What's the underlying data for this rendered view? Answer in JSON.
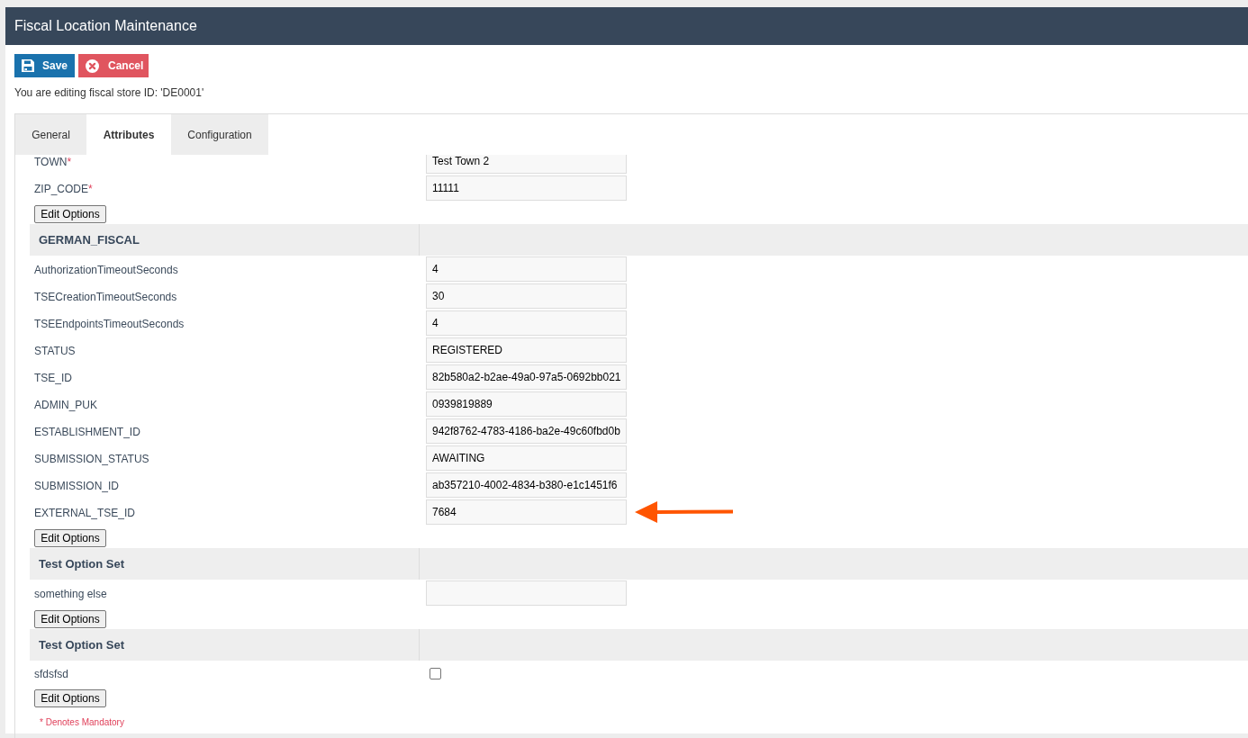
{
  "header": {
    "title": "Fiscal Location Maintenance"
  },
  "toolbar": {
    "buttons": [
      {
        "kind": "save",
        "label": "Save"
      },
      {
        "kind": "cancel",
        "label": "Cancel"
      }
    ]
  },
  "editing_notice": "You are editing fiscal store ID: 'DE0001'",
  "tabs": [
    {
      "label": "General",
      "selected": false
    },
    {
      "label": "Attributes",
      "selected": true
    },
    {
      "label": "Configuration",
      "selected": false
    }
  ],
  "sections": [
    {
      "fields": [
        {
          "label": "TOWN",
          "required_mark": "*",
          "kind": "text",
          "value": "Test Town 2",
          "highlighted": false
        },
        {
          "label": "ZIP_CODE",
          "required_mark": "*",
          "kind": "text",
          "value": "11111",
          "highlighted": false
        }
      ],
      "button": "Edit Options"
    },
    {
      "title": "GERMAN_FISCAL",
      "fields": [
        {
          "label": "AuthorizationTimeoutSeconds",
          "kind": "text",
          "value": "4",
          "highlighted": false
        },
        {
          "label": "TSECreationTimeoutSeconds",
          "kind": "text",
          "value": "30",
          "highlighted": false
        },
        {
          "label": "TSEEndpointsTimeoutSeconds",
          "kind": "text",
          "value": "4",
          "highlighted": false
        },
        {
          "label": "STATUS",
          "kind": "text",
          "value": "REGISTERED",
          "highlighted": false
        },
        {
          "label": "TSE_ID",
          "kind": "text",
          "value": "82b580a2-b2ae-49a0-97a5-0692bb021",
          "highlighted": false
        },
        {
          "label": "ADMIN_PUK",
          "kind": "text",
          "value": "0939819889",
          "highlighted": false
        },
        {
          "label": "ESTABLISHMENT_ID",
          "kind": "text",
          "value": "942f8762-4783-4186-ba2e-49c60fbd0b",
          "highlighted": false
        },
        {
          "label": "SUBMISSION_STATUS",
          "kind": "text",
          "value": "AWAITING",
          "highlighted": false
        },
        {
          "label": "SUBMISSION_ID",
          "kind": "text",
          "value": "ab357210-4002-4834-b380-e1c1451f6",
          "highlighted": false
        },
        {
          "label": "EXTERNAL_TSE_ID",
          "kind": "text",
          "value": "7684",
          "highlighted": true
        }
      ],
      "button": "Edit Options"
    },
    {
      "title": "Test Option Set",
      "fields": [
        {
          "label": "something else",
          "kind": "text",
          "highlighted": false
        }
      ],
      "button": "Edit Options"
    },
    {
      "title": "Test Option Set",
      "fields": [
        {
          "label": "sfdsfsd",
          "kind": "checkbox",
          "checked": false,
          "highlighted": false
        }
      ],
      "button": "Edit Options"
    }
  ],
  "footnote": "* Denotes Mandatory"
}
